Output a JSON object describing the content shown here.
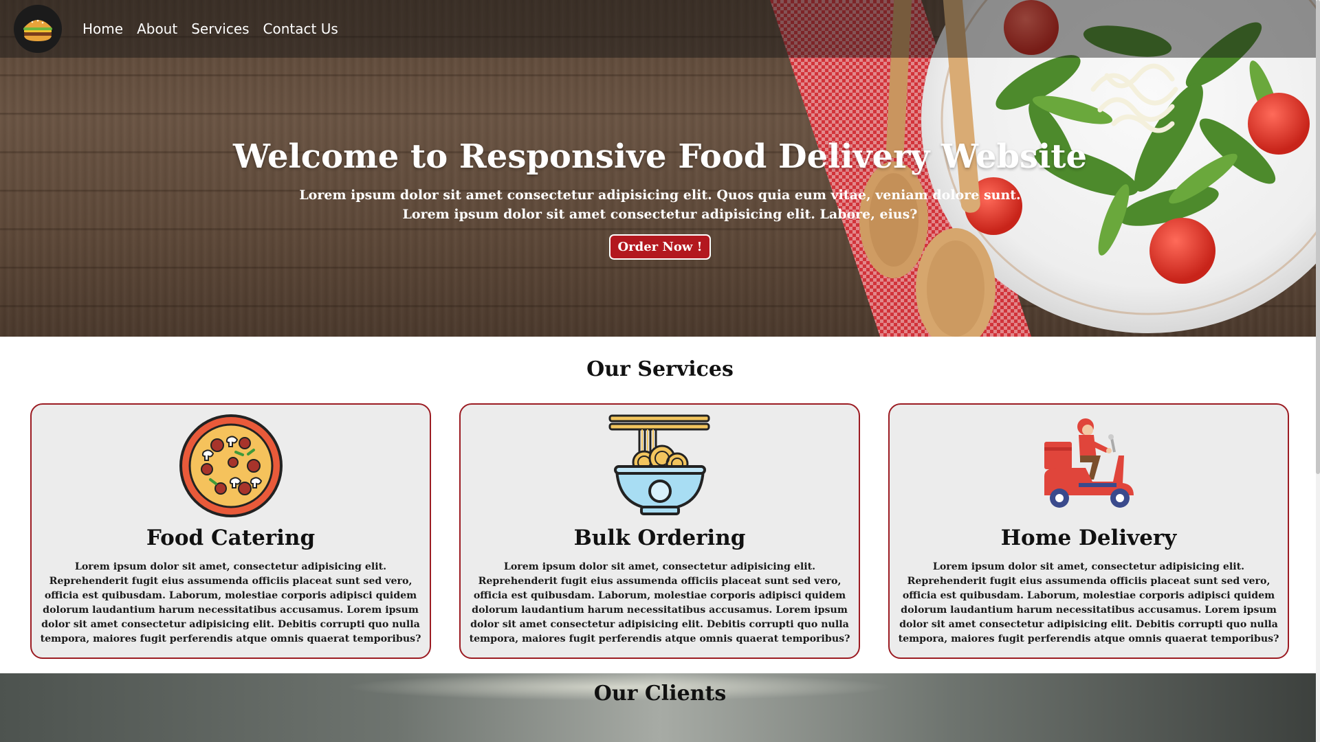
{
  "nav": {
    "logo_icon": "burger-icon",
    "links": [
      "Home",
      "About",
      "Services",
      "Contact Us"
    ]
  },
  "hero": {
    "title": "Welcome to Responsive Food Delivery Website",
    "subtitle_line1": "Lorem ipsum dolor sit amet consectetur adipisicing elit. Quos quia eum vitae, veniam dolore sunt.",
    "subtitle_line2": "Lorem ipsum dolor sit amet consectetur adipisicing elit. Labore, eius?",
    "button": "Order Now !"
  },
  "services": {
    "title": "Our Services",
    "cards": [
      {
        "icon": "pizza-icon",
        "title": "Food Catering",
        "text": "Lorem ipsum dolor sit amet, consectetur adipisicing elit. Reprehenderit fugit eius assumenda officiis placeat sunt sed vero, officia est quibusdam. Laborum, molestiae corporis adipisci quidem dolorum laudantium harum necessitatibus accusamus. Lorem ipsum dolor sit amet consectetur adipisicing elit. Debitis corrupti quo nulla tempora, maiores fugit perferendis atque omnis quaerat temporibus?"
      },
      {
        "icon": "noodle-bowl-icon",
        "title": "Bulk Ordering",
        "text": "Lorem ipsum dolor sit amet, consectetur adipisicing elit. Reprehenderit fugit eius assumenda officiis placeat sunt sed vero, officia est quibusdam. Laborum, molestiae corporis adipisci quidem dolorum laudantium harum necessitatibus accusamus. Lorem ipsum dolor sit amet consectetur adipisicing elit. Debitis corrupti quo nulla tempora, maiores fugit perferendis atque omnis quaerat temporibus?"
      },
      {
        "icon": "delivery-scooter-icon",
        "title": "Home Delivery",
        "text": "Lorem ipsum dolor sit amet, consectetur adipisicing elit. Reprehenderit fugit eius assumenda officiis placeat sunt sed vero, officia est quibusdam. Laborum, molestiae corporis adipisci quidem dolorum laudantium harum necessitatibus accusamus. Lorem ipsum dolor sit amet consectetur adipisicing elit. Debitis corrupti quo nulla tempora, maiores fugit perferendis atque omnis quaerat temporibus?"
      }
    ]
  },
  "clients": {
    "title": "Our Clients"
  },
  "colors": {
    "accent": "#b3181f",
    "card_border": "#9b1b22",
    "card_bg": "#ececec"
  }
}
